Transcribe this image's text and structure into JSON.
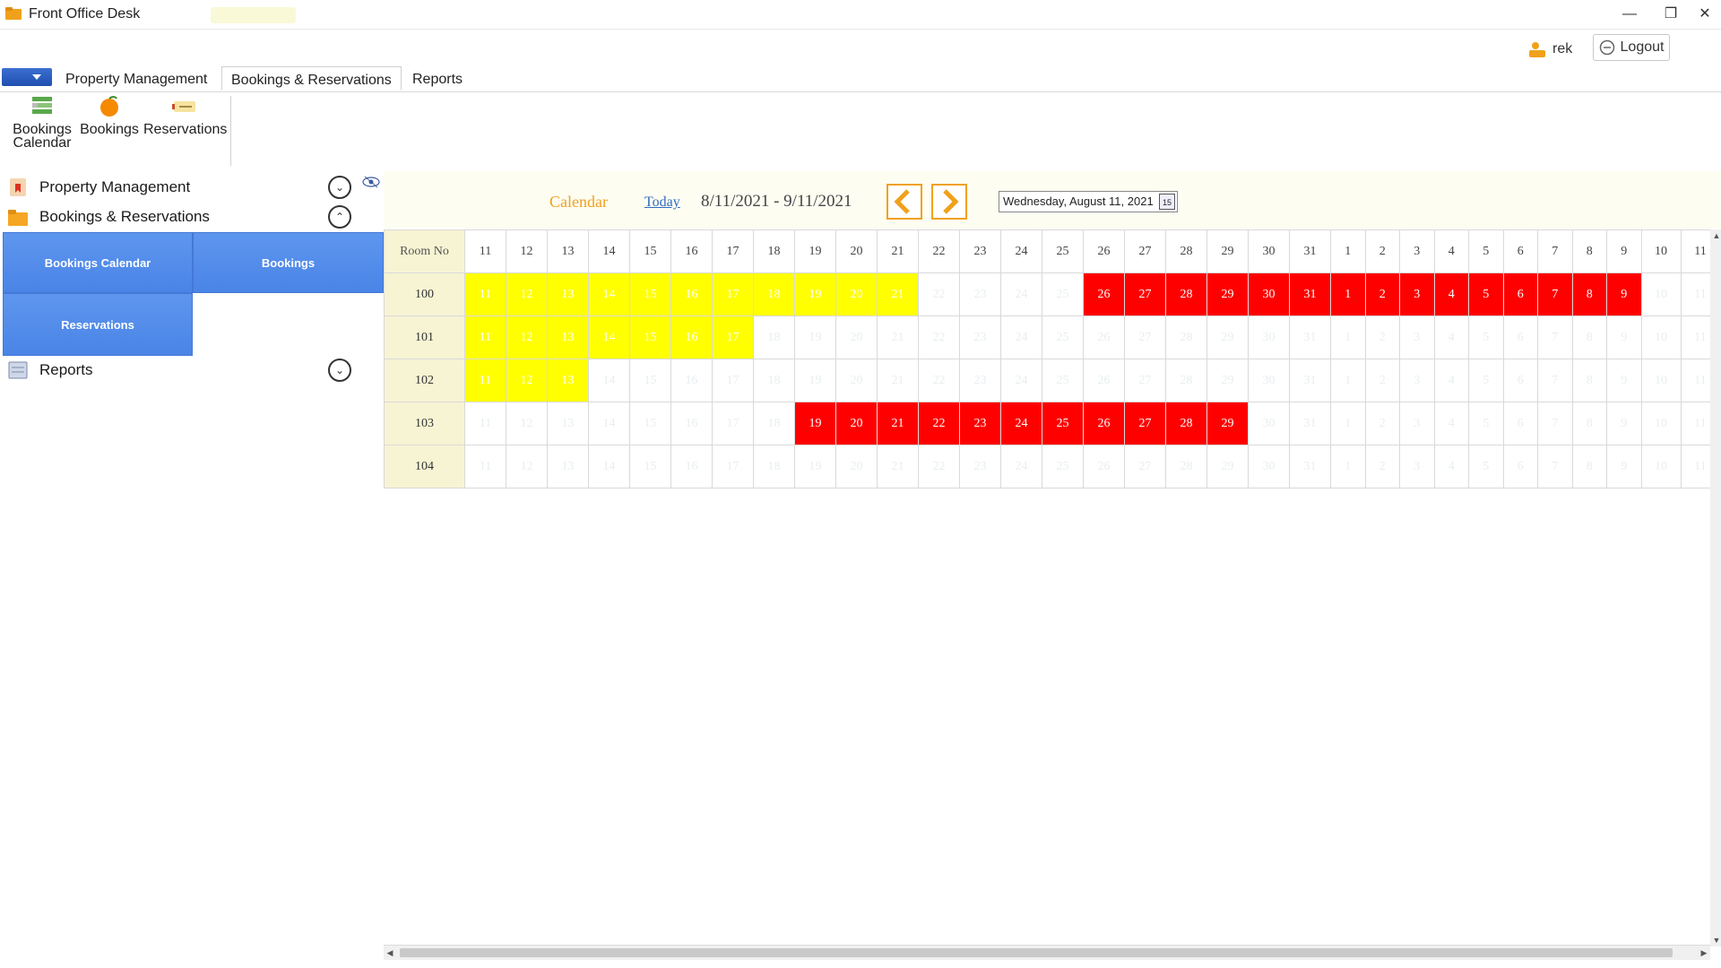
{
  "window": {
    "title": "Front Office Desk",
    "minimize": "—",
    "restore": "❐",
    "close": "✕"
  },
  "user": {
    "name": "rek",
    "logout_label": "Logout"
  },
  "menu": {
    "tabs": [
      "Property Management",
      "Bookings & Reservations",
      "Reports"
    ],
    "active_tab": "Bookings & Reservations"
  },
  "ribbon": {
    "buttons": [
      {
        "label_line1": "Bookings",
        "label_line2": "Calendar",
        "icon": "bookings-calendar-icon"
      },
      {
        "label_line1": "Bookings",
        "label_line2": "",
        "icon": "bookings-icon"
      },
      {
        "label_line1": "Reservations",
        "label_line2": "",
        "icon": "reservations-icon"
      }
    ]
  },
  "sidebar": {
    "sections": [
      {
        "label": "Property Management",
        "icon": "property-icon",
        "state": "collapsed"
      },
      {
        "label": "Bookings & Reservations",
        "icon": "folder-icon",
        "state": "expanded"
      },
      {
        "label": "Reports",
        "icon": "reports-icon",
        "state": "collapsed"
      }
    ],
    "tiles": [
      "Bookings Calendar",
      "Bookings",
      "Reservations"
    ]
  },
  "calendar": {
    "title": "Calendar",
    "today_label": "Today",
    "date_range": "8/11/2021 - 9/11/2021",
    "date_picker_value": "Wednesday, August 11, 2021",
    "date_picker_icon_text": "15",
    "room_header": "Room No",
    "days": [
      "11",
      "12",
      "13",
      "14",
      "15",
      "16",
      "17",
      "18",
      "19",
      "20",
      "21",
      "22",
      "23",
      "24",
      "25",
      "26",
      "27",
      "28",
      "29",
      "30",
      "31",
      "1",
      "2",
      "3",
      "4",
      "5",
      "6",
      "7",
      "8",
      "9",
      "10",
      "11"
    ],
    "rooms": [
      {
        "room": "100",
        "yellow": [
          0,
          1,
          2,
          3,
          4,
          5,
          6,
          7,
          8,
          9,
          10
        ],
        "red": [
          15,
          16,
          17,
          18,
          19,
          20,
          21,
          22,
          23,
          24,
          25,
          26,
          27,
          28,
          29
        ]
      },
      {
        "room": "101",
        "yellow": [
          0,
          1,
          2,
          3,
          4,
          5,
          6
        ],
        "red": []
      },
      {
        "room": "102",
        "yellow": [
          0,
          1,
          2
        ],
        "red": []
      },
      {
        "room": "103",
        "yellow": [],
        "red": [
          8,
          9,
          10,
          11,
          12,
          13,
          14,
          15,
          16,
          17,
          18
        ]
      },
      {
        "room": "104",
        "yellow": [],
        "red": []
      }
    ],
    "colors": {
      "booking": "#ffff00",
      "reservation": "#ff0000",
      "accent": "#f0a11b",
      "tile": "#5e96ef"
    }
  }
}
